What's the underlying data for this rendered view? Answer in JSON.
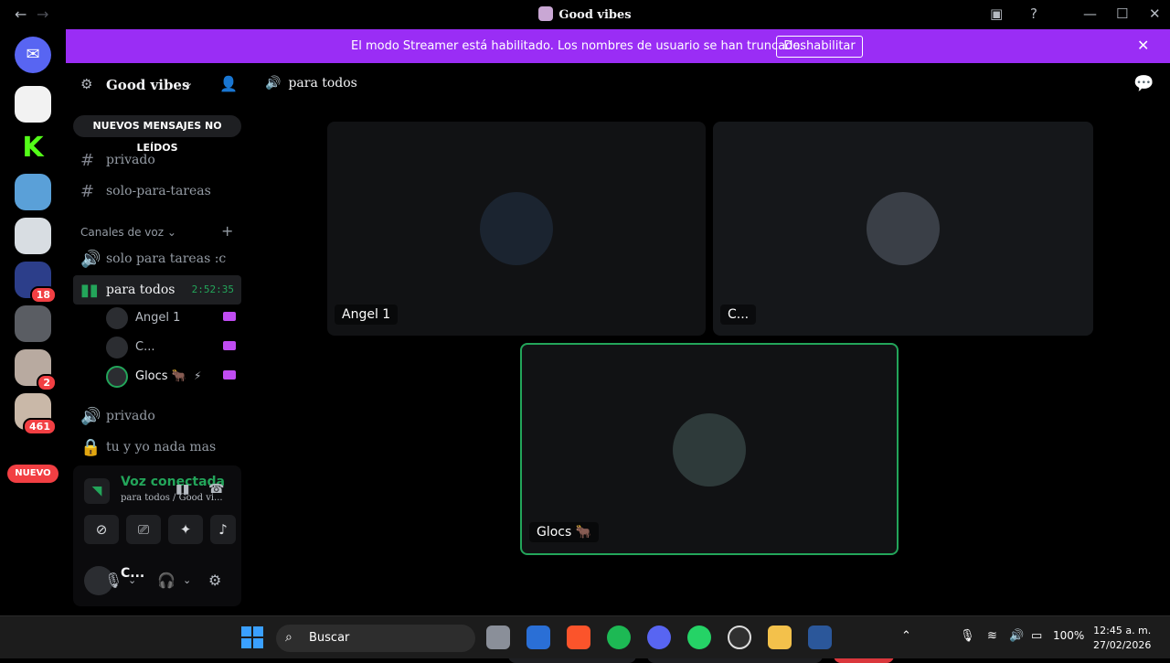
{
  "window": {
    "title": "Good vibes",
    "nav_back": "←",
    "nav_forward": "→"
  },
  "banner": {
    "message": "El modo Streamer está habilitado. Los nombres de usuario se han truncado.",
    "button": "Deshabilitar",
    "close": "✕"
  },
  "guilds": {
    "badges": [
      "18",
      "2",
      "461"
    ],
    "new_label": "NUEVO"
  },
  "server": {
    "name": "Good vibes",
    "unread_banner": "NUEVOS MENSAJES NO LEÍDOS"
  },
  "channels": {
    "text": [
      {
        "icon": "#",
        "label": "privado"
      },
      {
        "icon": "#",
        "label": "solo-para-tareas"
      }
    ],
    "voice_category": "Canales de voz ⌄",
    "voice": [
      {
        "label": "solo para tareas :c"
      },
      {
        "label": "para todos",
        "timer": "2:52:35"
      },
      {
        "label": "privado"
      },
      {
        "label": "tu y yo nada mas"
      }
    ],
    "voice_users": [
      {
        "name": "Angel 1"
      },
      {
        "name": "C..."
      },
      {
        "name": "Glocs 🐂"
      }
    ]
  },
  "voice_panel": {
    "title": "Voz conectada",
    "subtitle": "para todos / Good vi..."
  },
  "user": {
    "name": "C..."
  },
  "call": {
    "channel": "para todos",
    "tiles": [
      {
        "name": "Angel 1"
      },
      {
        "name": "C..."
      },
      {
        "name": "Glocs 🐂"
      }
    ]
  },
  "taskbar": {
    "search": "Buscar",
    "battery": "100%",
    "time": "12:45 a. m.",
    "date": "27/02/2026"
  },
  "colors": {
    "banner": "#9a2df5",
    "connected_green": "#23a55a",
    "leave_red": "#da373c",
    "badge_red": "#f23f43"
  }
}
